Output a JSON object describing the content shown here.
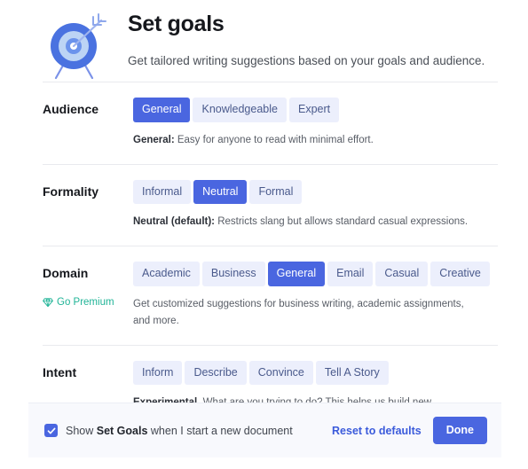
{
  "header": {
    "title": "Set goals",
    "subtitle": "Get tailored writing suggestions based on your goals and audience.",
    "icon": "target-with-arrow-icon"
  },
  "sections": [
    {
      "label": "Audience",
      "options": [
        "General",
        "Knowledgeable",
        "Expert"
      ],
      "selected": "General",
      "description_bold": "General:",
      "description_rest": " Easy for anyone to read with minimal effort.",
      "gutter_link": null
    },
    {
      "label": "Formality",
      "options": [
        "Informal",
        "Neutral",
        "Formal"
      ],
      "selected": "Neutral",
      "description_bold": "Neutral (default):",
      "description_rest": " Restricts slang but allows standard casual expressions.",
      "gutter_link": null
    },
    {
      "label": "Domain",
      "options": [
        "Academic",
        "Business",
        "General",
        "Email",
        "Casual",
        "Creative"
      ],
      "selected": "General",
      "description_bold": "",
      "description_rest": "Get customized suggestions for business writing, academic assignments, and more.",
      "gutter_link": {
        "label": "Go Premium",
        "icon": "gem-icon",
        "color": "#20b497"
      }
    },
    {
      "label": "Intent",
      "options": [
        "Inform",
        "Describe",
        "Convince",
        "Tell A Story"
      ],
      "selected": null,
      "description_bold": "Experimental.",
      "description_rest": " What are you trying to do? This helps us build new suggestions and won't affect your feedback today.",
      "gutter_link": null
    }
  ],
  "footer": {
    "checkbox_checked": true,
    "checkbox_label_pre": "Show ",
    "checkbox_label_bold": "Set Goals",
    "checkbox_label_post": " when I start a new document",
    "reset_label": "Reset to defaults",
    "done_label": "Done"
  },
  "colors": {
    "accent_blue": "#4a66e0",
    "link_blue": "#3b5bdb",
    "pill_bg": "#eceffc",
    "pill_text": "#4a5a8c",
    "premium_green": "#20b497",
    "footer_bg": "#f8f9fd",
    "divider": "#e9eaee"
  }
}
